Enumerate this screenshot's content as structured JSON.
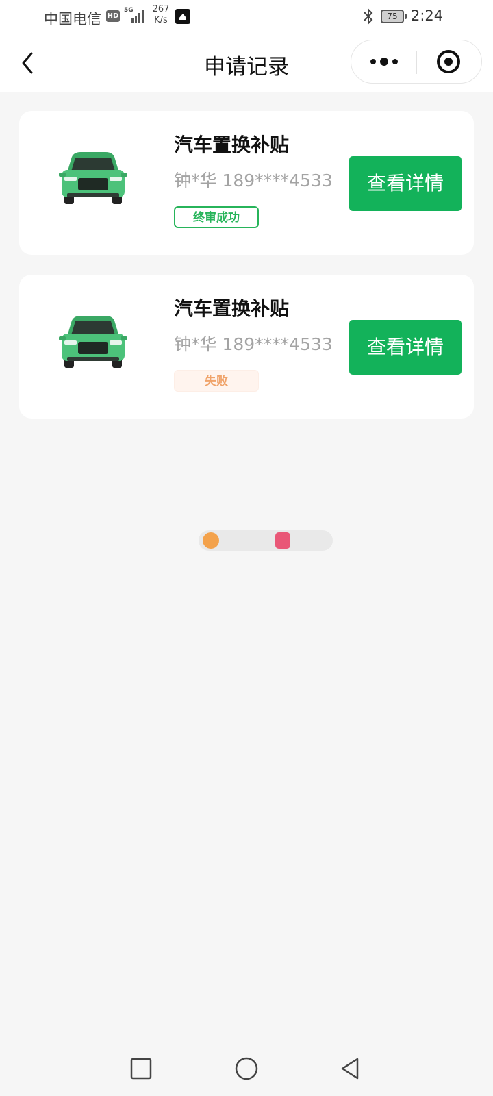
{
  "status_bar": {
    "carrier": "中国电信",
    "hd": "HD",
    "network": "5G",
    "speed_value": "267",
    "speed_unit": "K/s",
    "battery": "75",
    "time": "2:24"
  },
  "nav": {
    "title": "申请记录",
    "more_icon": "more-dots-icon",
    "close_icon": "target-close-icon"
  },
  "records": [
    {
      "title": "汽车置换补贴",
      "info": "钟*华 189****4533",
      "status": "终审成功",
      "status_type": "success",
      "button": "查看详情"
    },
    {
      "title": "汽车置换补贴",
      "info": "钟*华 189****4533",
      "status": "失败",
      "status_type": "fail",
      "button": "查看详情"
    }
  ],
  "colors": {
    "primary": "#13b25a",
    "success": "#27b45a",
    "fail": "#f0a36a",
    "background": "#f6f6f6",
    "car_body": "#4cc27a"
  }
}
